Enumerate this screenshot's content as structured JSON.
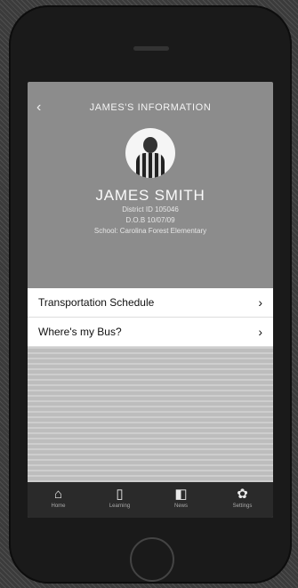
{
  "header": {
    "title": "JAMES'S INFORMATION",
    "back_icon": "chevron-left-icon"
  },
  "profile": {
    "name": "JAMES SMITH",
    "district_id": "District ID 105046",
    "dob": "D.O.B 10/07/09",
    "school": "School: Carolina Forest Elementary"
  },
  "menu": [
    {
      "label": "Transportation Schedule",
      "icon": "chevron-right-icon"
    },
    {
      "label": "Where's my Bus?",
      "icon": "chevron-right-icon"
    }
  ],
  "tabs": [
    {
      "icon": "home-icon",
      "glyph": "⌂",
      "label": "Home"
    },
    {
      "icon": "book-icon",
      "glyph": "▯",
      "label": "Learning"
    },
    {
      "icon": "bookmark-icon",
      "glyph": "◧",
      "label": "News"
    },
    {
      "icon": "gear-icon",
      "glyph": "✿",
      "label": "Settings"
    }
  ]
}
